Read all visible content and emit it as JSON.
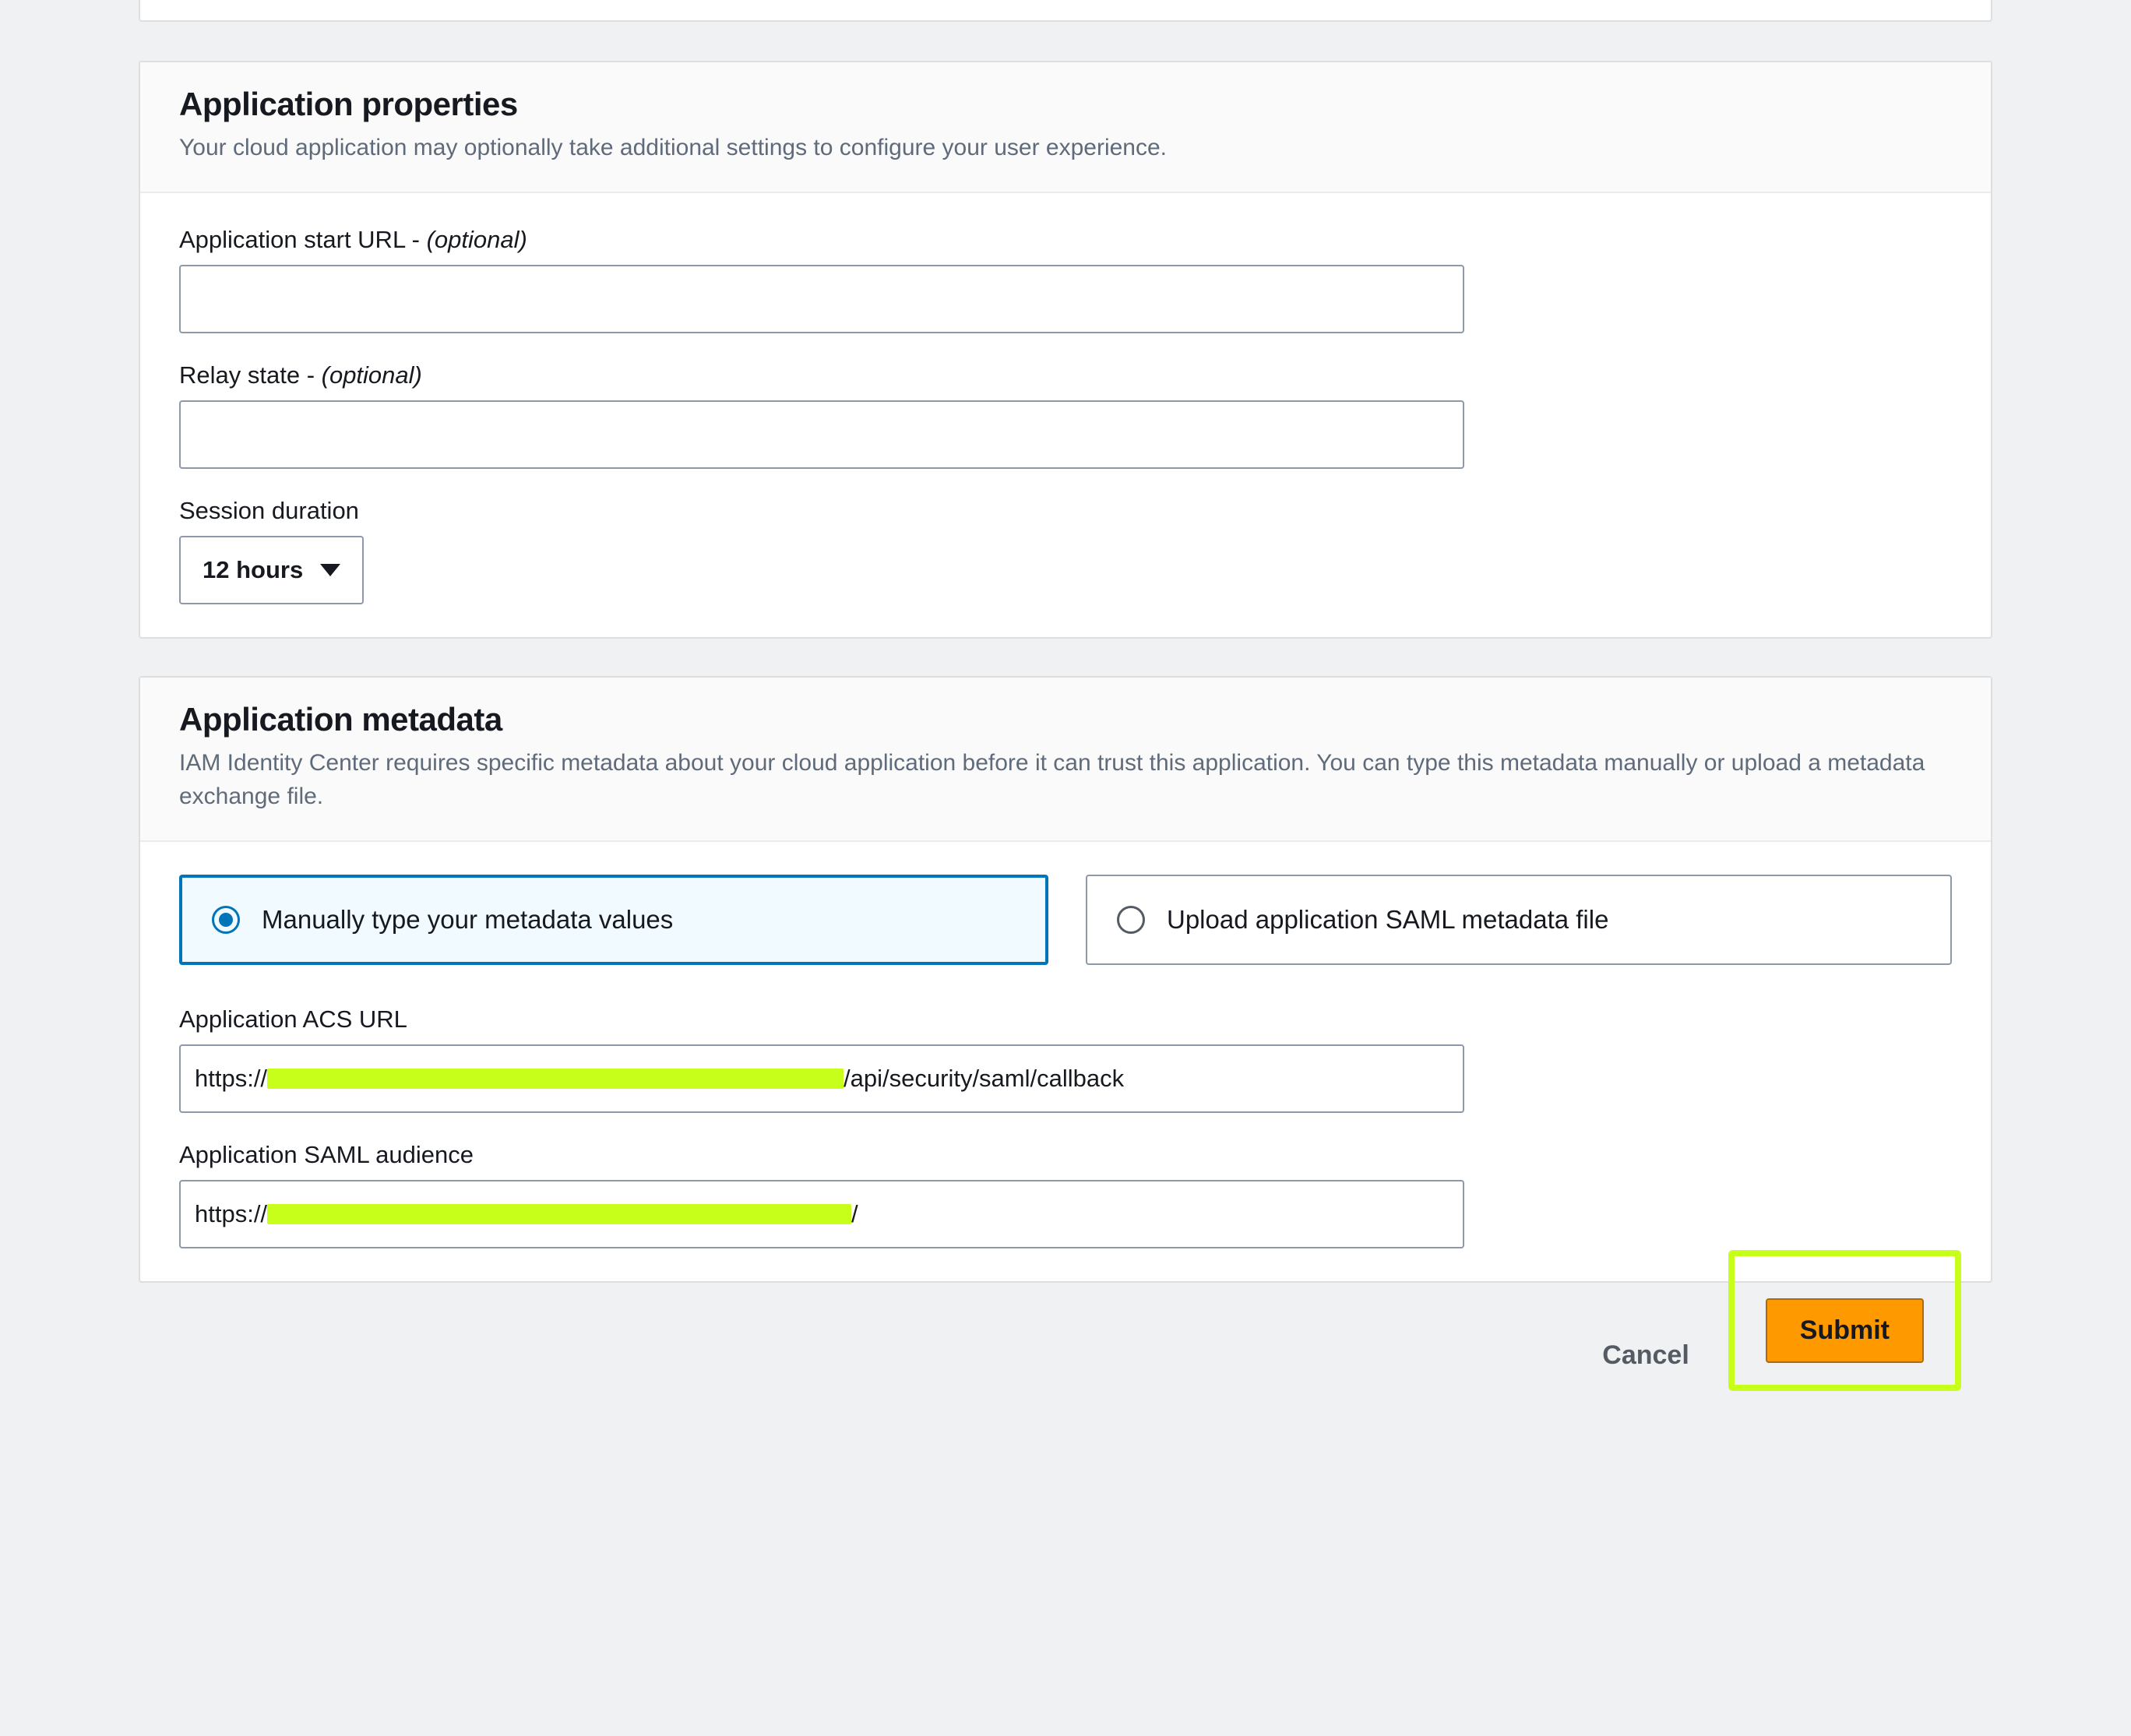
{
  "properties_card": {
    "title": "Application properties",
    "subtitle": "Your cloud application may optionally take additional settings to configure your user experience.",
    "start_url_label": "Application start URL - ",
    "start_url_optional": "(optional)",
    "start_url_value": "",
    "relay_state_label": "Relay state - ",
    "relay_state_optional": "(optional)",
    "relay_state_value": "",
    "session_duration_label": "Session duration",
    "session_duration_value": "12 hours"
  },
  "metadata_card": {
    "title": "Application metadata",
    "subtitle": "IAM Identity Center requires specific metadata about your cloud application before it can trust this application. You can type this metadata manually or upload a metadata exchange file.",
    "radio_manual": "Manually type your metadata values",
    "radio_upload": "Upload application SAML metadata file",
    "radio_selected": "manual",
    "acs_label": "Application ACS URL",
    "acs_prefix": "https://",
    "acs_suffix": "/api/security/saml/callback",
    "audience_label": "Application SAML audience",
    "audience_prefix": "https://",
    "audience_suffix": "/"
  },
  "actions": {
    "cancel": "Cancel",
    "submit": "Submit"
  }
}
